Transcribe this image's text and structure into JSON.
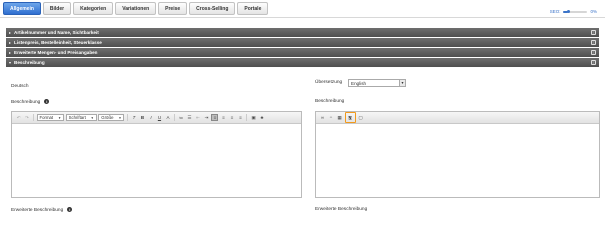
{
  "tabs": [
    {
      "label": "Allgemein",
      "active": true
    },
    {
      "label": "Bilder",
      "active": false
    },
    {
      "label": "Kategorien",
      "active": false
    },
    {
      "label": "Variationen",
      "active": false
    },
    {
      "label": "Preise",
      "active": false
    },
    {
      "label": "Cross-Selling",
      "active": false
    },
    {
      "label": "Portale",
      "active": false
    }
  ],
  "seo": {
    "label": "SEO:",
    "value": "0%",
    "progress": 0.2
  },
  "sections": [
    {
      "label": "Artikelnummer und Name, Sichtbarkeit",
      "expanded": false
    },
    {
      "label": "Listenpreis, Bestelleinheit, Steuerklasse",
      "expanded": false
    },
    {
      "label": "Erweiterte Mengen- und Preisangaben",
      "expanded": false
    },
    {
      "label": "Beschreibung",
      "expanded": true
    }
  ],
  "description": {
    "left_language": "Deutsch",
    "translation_label": "Übersetzung",
    "translation_value": "English",
    "left_field_label": "Beschreibung",
    "right_field_label": "Beschreibung",
    "left_ext_label": "Erweiterte Beschreibung",
    "right_ext_label": "Erweiterte Beschreibung"
  },
  "toolbar": {
    "format": "Format",
    "font": "Schriftart",
    "size": "Größe"
  },
  "colors": {
    "accent": "#3a73c9",
    "highlight": "#f29a1c",
    "section_bar": "#5a5a5a"
  }
}
